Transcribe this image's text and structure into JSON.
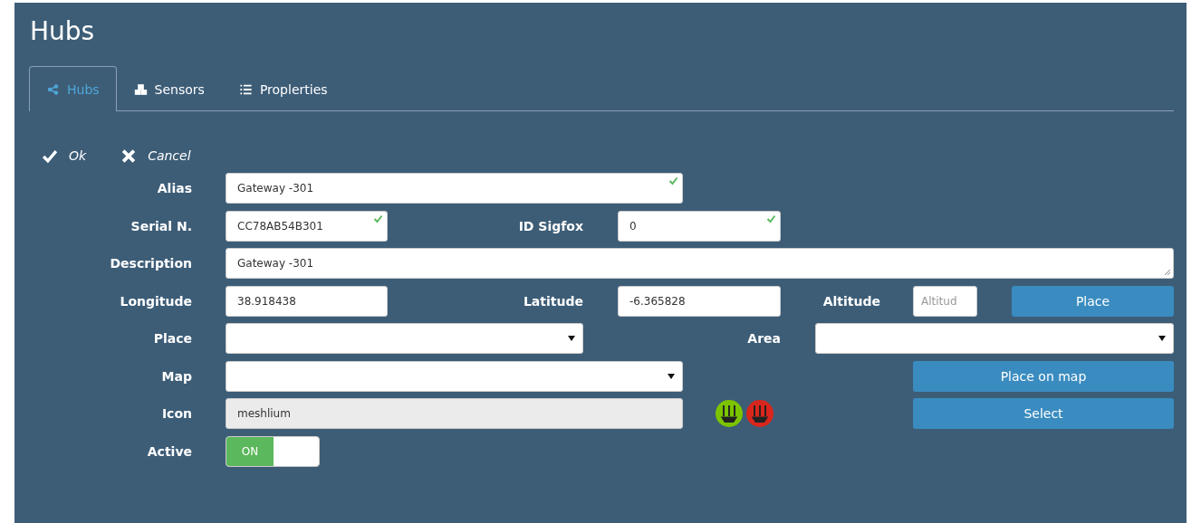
{
  "title": "Hubs",
  "tabs": [
    {
      "label": "Hubs",
      "kind": "share",
      "selected": true
    },
    {
      "label": "Sensors",
      "kind": "cubes",
      "selected": false
    },
    {
      "label": "Proplerties",
      "kind": "list",
      "selected": false
    }
  ],
  "actions": [
    {
      "label": "Ok",
      "kind": "ok"
    },
    {
      "label": "Cancel",
      "kind": "cancel"
    }
  ],
  "form": {
    "alias": {
      "label": "Alias",
      "value": "Gateway -301",
      "valid": true
    },
    "serial": {
      "label": "Serial N.",
      "value": "CC78AB54B301",
      "valid": true
    },
    "id_sigfox": {
      "label": "ID Sigfox",
      "value": "0",
      "valid": true
    },
    "description": {
      "label": "Description",
      "value": "Gateway -301"
    },
    "longitude": {
      "label": "Longitude",
      "value": "38.918438"
    },
    "latitude": {
      "label": "Latitude",
      "value": "-6.365828"
    },
    "altitude": {
      "label": "Altitude",
      "placeholder": "Altitud"
    },
    "place_button": "Place",
    "place": {
      "label": "Place"
    },
    "area": {
      "label": "Area"
    },
    "map": {
      "label": "Map"
    },
    "place_on_map_button": "Place on map",
    "icon": {
      "label": "Icon",
      "value": "meshlium"
    },
    "icon_options": [
      {
        "color": "#7cc400"
      },
      {
        "color": "#d9261c"
      }
    ],
    "select_button": "Select",
    "active": {
      "label": "Active",
      "on": true,
      "on_text": "ON"
    }
  }
}
